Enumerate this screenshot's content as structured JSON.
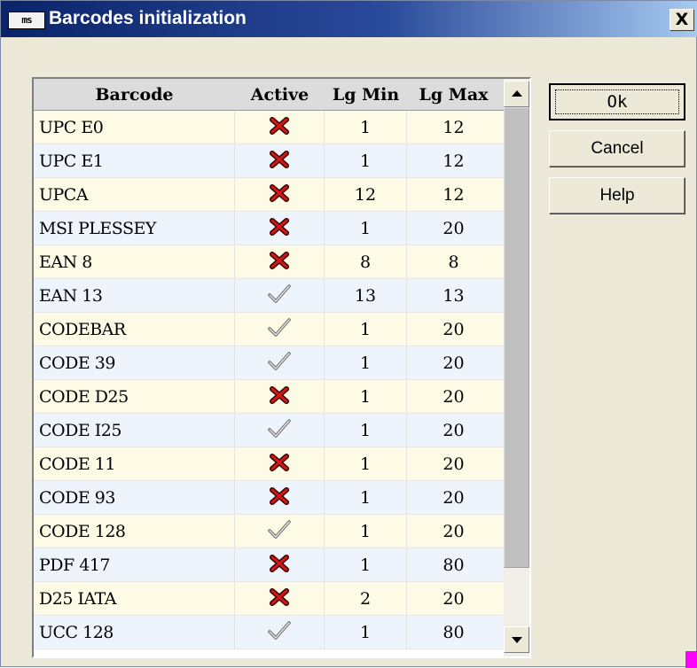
{
  "window": {
    "title": "Barcodes initialization",
    "title_icon_text": "ms",
    "close_label": "X",
    "title_gradient_start": "#0a246a",
    "title_gradient_end": "#a6caf0"
  },
  "grid": {
    "columns": [
      "Barcode",
      "Active",
      "Lg Min",
      "Lg Max"
    ],
    "rows": [
      {
        "name": "UPC E0",
        "active": false,
        "min": "1",
        "max": "12"
      },
      {
        "name": "UPC E1",
        "active": false,
        "min": "1",
        "max": "12"
      },
      {
        "name": "UPCA",
        "active": false,
        "min": "12",
        "max": "12"
      },
      {
        "name": "MSI PLESSEY",
        "active": false,
        "min": "1",
        "max": "20"
      },
      {
        "name": "EAN 8",
        "active": false,
        "min": "8",
        "max": "8"
      },
      {
        "name": "EAN 13",
        "active": true,
        "min": "13",
        "max": "13"
      },
      {
        "name": "CODEBAR",
        "active": true,
        "min": "1",
        "max": "20"
      },
      {
        "name": "CODE 39",
        "active": true,
        "min": "1",
        "max": "20"
      },
      {
        "name": "CODE D25",
        "active": false,
        "min": "1",
        "max": "20"
      },
      {
        "name": "CODE I25",
        "active": true,
        "min": "1",
        "max": "20"
      },
      {
        "name": "CODE 11",
        "active": false,
        "min": "1",
        "max": "20"
      },
      {
        "name": "CODE 93",
        "active": false,
        "min": "1",
        "max": "20"
      },
      {
        "name": "CODE 128",
        "active": true,
        "min": "1",
        "max": "20"
      },
      {
        "name": "PDF 417",
        "active": false,
        "min": "1",
        "max": "80"
      },
      {
        "name": "D25 IATA",
        "active": false,
        "min": "2",
        "max": "20"
      },
      {
        "name": "UCC 128",
        "active": true,
        "min": "1",
        "max": "80"
      }
    ],
    "active_icon": "check-icon",
    "inactive_icon": "cross-icon",
    "row_colors": {
      "odd": "#fdfbe6",
      "even": "#eef4fc"
    }
  },
  "buttons": {
    "ok": "Ok",
    "cancel": "Cancel",
    "help": "Help"
  }
}
